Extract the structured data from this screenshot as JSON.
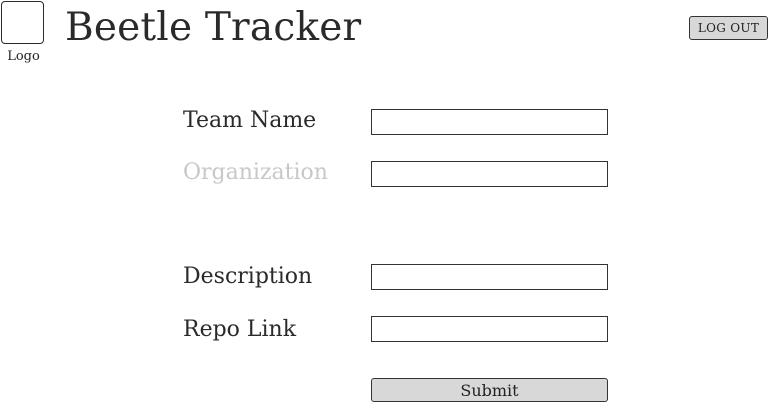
{
  "header": {
    "logo_label": "Logo",
    "app_title": "Beetle Tracker",
    "logout_label": "LOG OUT"
  },
  "form": {
    "fields": [
      {
        "label": "Team Name",
        "value": "",
        "state": "active"
      },
      {
        "label": "Organization",
        "value": "",
        "state": "muted"
      },
      {
        "label": "Description",
        "value": "",
        "state": "active"
      },
      {
        "label": "Repo Link",
        "value": "",
        "state": "active"
      }
    ],
    "submit_label": "Submit"
  },
  "colors": {
    "button_bg": "#d8d8d8",
    "muted_label": "#c8c8c8",
    "text": "#2a2a2a"
  }
}
